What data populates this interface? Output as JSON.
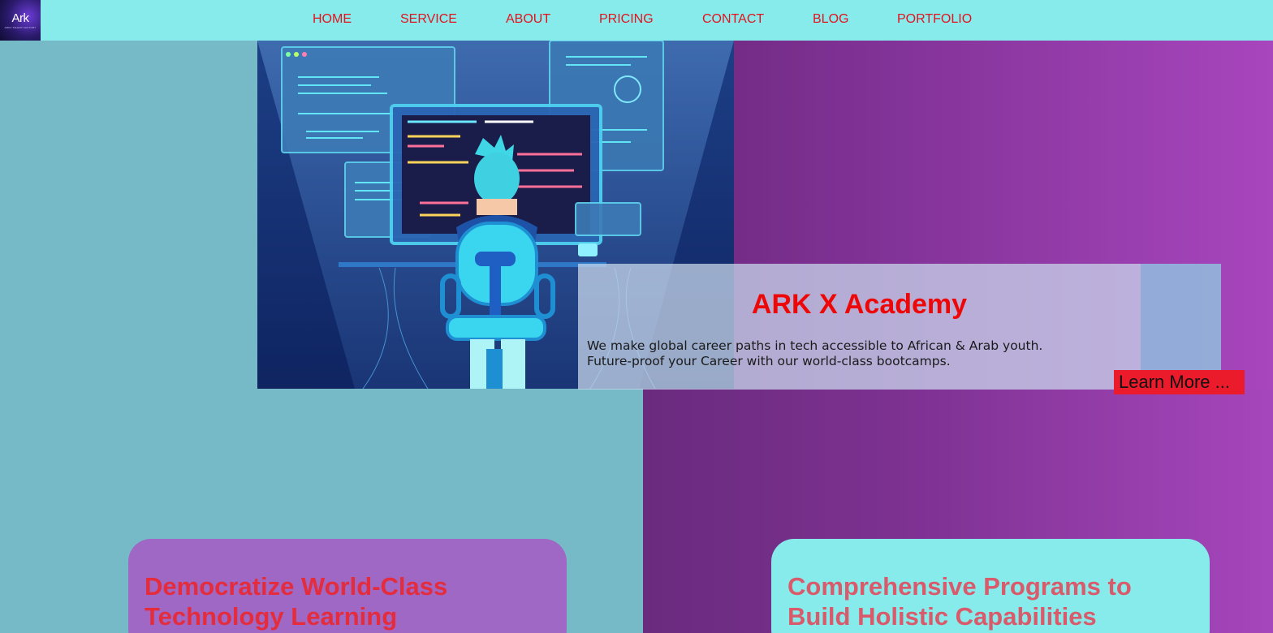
{
  "brand": {
    "logo_text": "Ark",
    "logo_tagline": "ARKX TALENT FACTORY"
  },
  "nav": {
    "items": [
      {
        "label": "HOME"
      },
      {
        "label": "SERVICE"
      },
      {
        "label": "ABOUT"
      },
      {
        "label": "PRICING"
      },
      {
        "label": "CONTACT"
      },
      {
        "label": "BLOG"
      },
      {
        "label": "PORTFOLIO"
      }
    ]
  },
  "hero": {
    "title": "ARK X Academy",
    "line1": "We make global career paths in tech accessible to African & Arab youth.",
    "line2": "Future-proof your Career with our world-class bootcamps.",
    "cta_label": "Learn More ..."
  },
  "features": [
    {
      "title": "Democratize World-Class Technology Learning"
    },
    {
      "title": "Comprehensive Programs to Build Holistic Capabilities"
    }
  ],
  "colors": {
    "nav_bg": "#86ebea",
    "nav_link": "#e3141f",
    "title_red": "#ee0707",
    "cta_bg": "#ec1b2c",
    "left_bg": "#77bac7",
    "right_bg_start": "#6a2b7e",
    "right_bg_end": "#a646bc"
  }
}
